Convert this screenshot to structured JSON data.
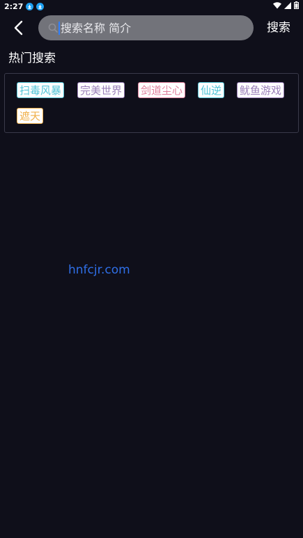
{
  "status_bar": {
    "time": "2:27"
  },
  "header": {
    "search_placeholder": "搜索名称 简介",
    "search_button": "搜索"
  },
  "hot_search": {
    "title": "热门搜索",
    "tags": [
      {
        "label": "扫毒风暴",
        "color": "#4fc3d6"
      },
      {
        "label": "完美世界",
        "color": "#9a7fb8"
      },
      {
        "label": "剑道尘心",
        "color": "#e07f9c"
      },
      {
        "label": "仙逆",
        "color": "#4fc3d6"
      },
      {
        "label": "鱿鱼游戏",
        "color": "#9a7fb8"
      },
      {
        "label": "遮天",
        "color": "#f0b04a"
      }
    ]
  },
  "watermark": "hnfcjr.com",
  "colors": {
    "background": "#0f0f1a",
    "accent": "#2f80ff",
    "download_badge": "#1ea1f2"
  }
}
